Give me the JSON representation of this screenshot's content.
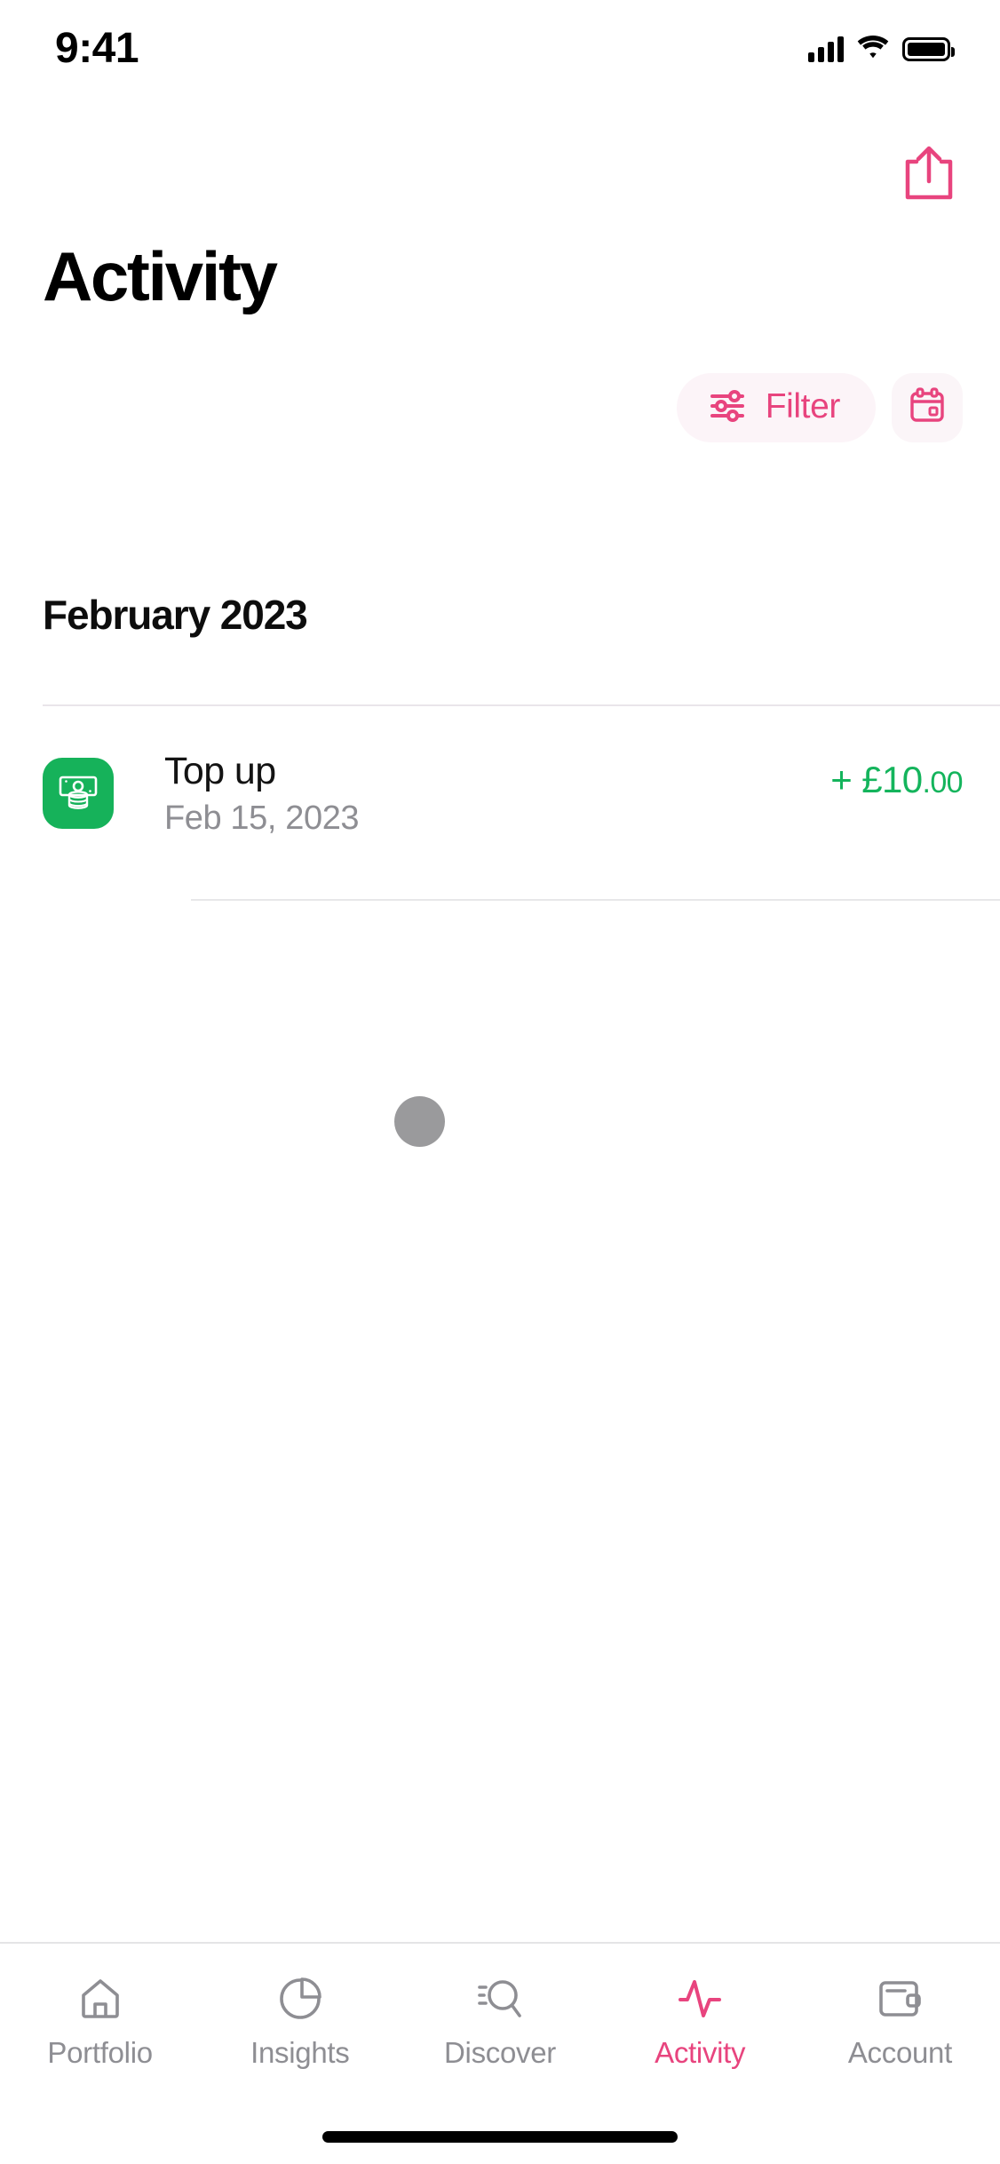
{
  "status_bar": {
    "time": "9:41",
    "cellular_icon": "signal-bars-icon",
    "wifi_icon": "wifi-icon",
    "battery_icon": "battery-icon"
  },
  "header": {
    "share_icon": "share-icon",
    "title": "Activity"
  },
  "actions": {
    "filter": {
      "label": "Filter",
      "icon": "sliders-icon"
    },
    "calendar": {
      "icon": "calendar-icon",
      "label": ""
    }
  },
  "sections": [
    {
      "month_label": "February 2023",
      "transactions": [
        {
          "icon": "banknote-coins-icon",
          "icon_color": "#16b25a",
          "title": "Top up",
          "date": "Feb 15, 2023",
          "amount_sign": "+ ",
          "amount_currency": "£",
          "amount_whole": "10",
          "amount_cents": ".00",
          "amount_color": "#14b45c"
        }
      ]
    }
  ],
  "cursor": {
    "name": "pointer-dot",
    "color": "#9a9a9c"
  },
  "tabbar": {
    "items": [
      {
        "label": "Portfolio",
        "icon": "home-icon",
        "active": false
      },
      {
        "label": "Insights",
        "icon": "pie-chart-icon",
        "active": false
      },
      {
        "label": "Discover",
        "icon": "search-icon",
        "active": false
      },
      {
        "label": "Activity",
        "icon": "pulse-icon",
        "active": true
      },
      {
        "label": "Account",
        "icon": "wallet-icon",
        "active": false
      }
    ]
  },
  "colors": {
    "accent_pink": "#e8447e",
    "accent_pink_bg": "#fcf4f8",
    "green": "#16b25a",
    "text_primary": "#0d0d0d",
    "text_secondary": "#8e8e93",
    "divider": "#e7e7e9"
  }
}
